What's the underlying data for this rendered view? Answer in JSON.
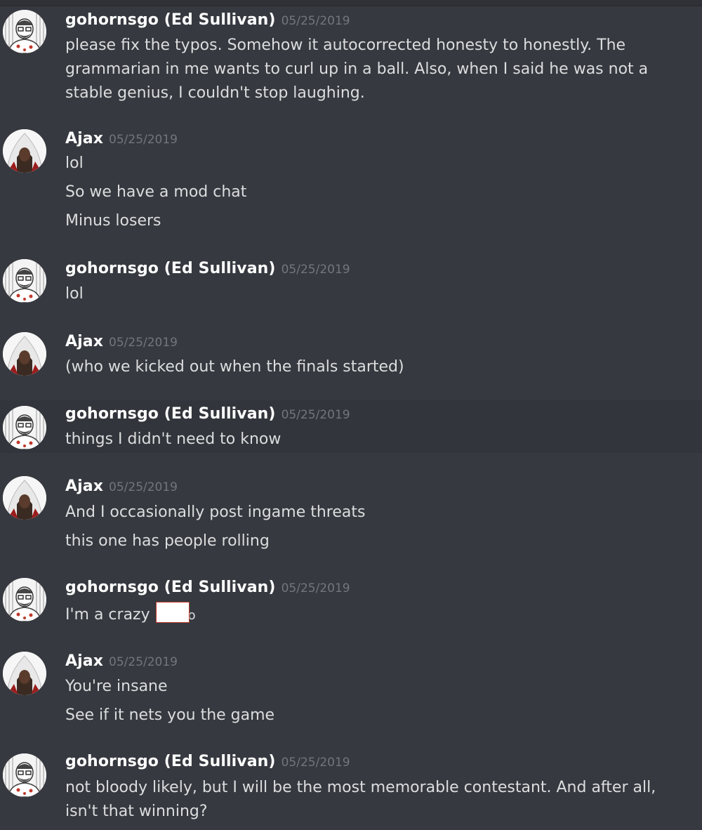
{
  "users": {
    "ed": "gohornsgo (Ed Sullivan)",
    "ajax": "Ajax"
  },
  "messages": [
    {
      "user": "gohornsgo (Ed Sullivan)",
      "timestamp": "05/25/2019",
      "lines": [
        "please fix the typos.  Somehow it autocorrected honesty to honestly.  The",
        "grammarian in me wants to curl up in a ball.  Also, when I said he was not a",
        "stable genius, I couldn't stop laughing."
      ]
    },
    {
      "user": "Ajax",
      "timestamp": "05/25/2019",
      "lines": [
        "lol",
        "So we have a mod chat",
        "Minus losers"
      ]
    },
    {
      "user": "gohornsgo (Ed Sullivan)",
      "timestamp": "05/25/2019",
      "lines": [
        "lol"
      ]
    },
    {
      "user": "Ajax",
      "timestamp": "05/25/2019",
      "lines": [
        "(who we kicked out when the finals started)"
      ]
    },
    {
      "user": "gohornsgo (Ed Sullivan)",
      "timestamp": "05/25/2019",
      "lines": [
        "things I didn't need to know"
      ]
    },
    {
      "user": "Ajax",
      "timestamp": "05/25/2019",
      "lines": [
        "And I occasionally post ingame threats",
        "this one has people rolling"
      ]
    },
    {
      "user": "gohornsgo (Ed Sullivan)",
      "timestamp": "05/25/2019",
      "lines": [
        "I'm a crazy"
      ],
      "redacted_tail": "o"
    },
    {
      "user": "Ajax",
      "timestamp": "05/25/2019",
      "lines": [
        "You're insane",
        "See if it nets you the game"
      ]
    },
    {
      "user": "gohornsgo (Ed Sullivan)",
      "timestamp": "05/25/2019",
      "lines": [
        "not bloody likely, but I will be the most memorable contestant.  And after all,",
        "isn't that winning?"
      ]
    }
  ]
}
